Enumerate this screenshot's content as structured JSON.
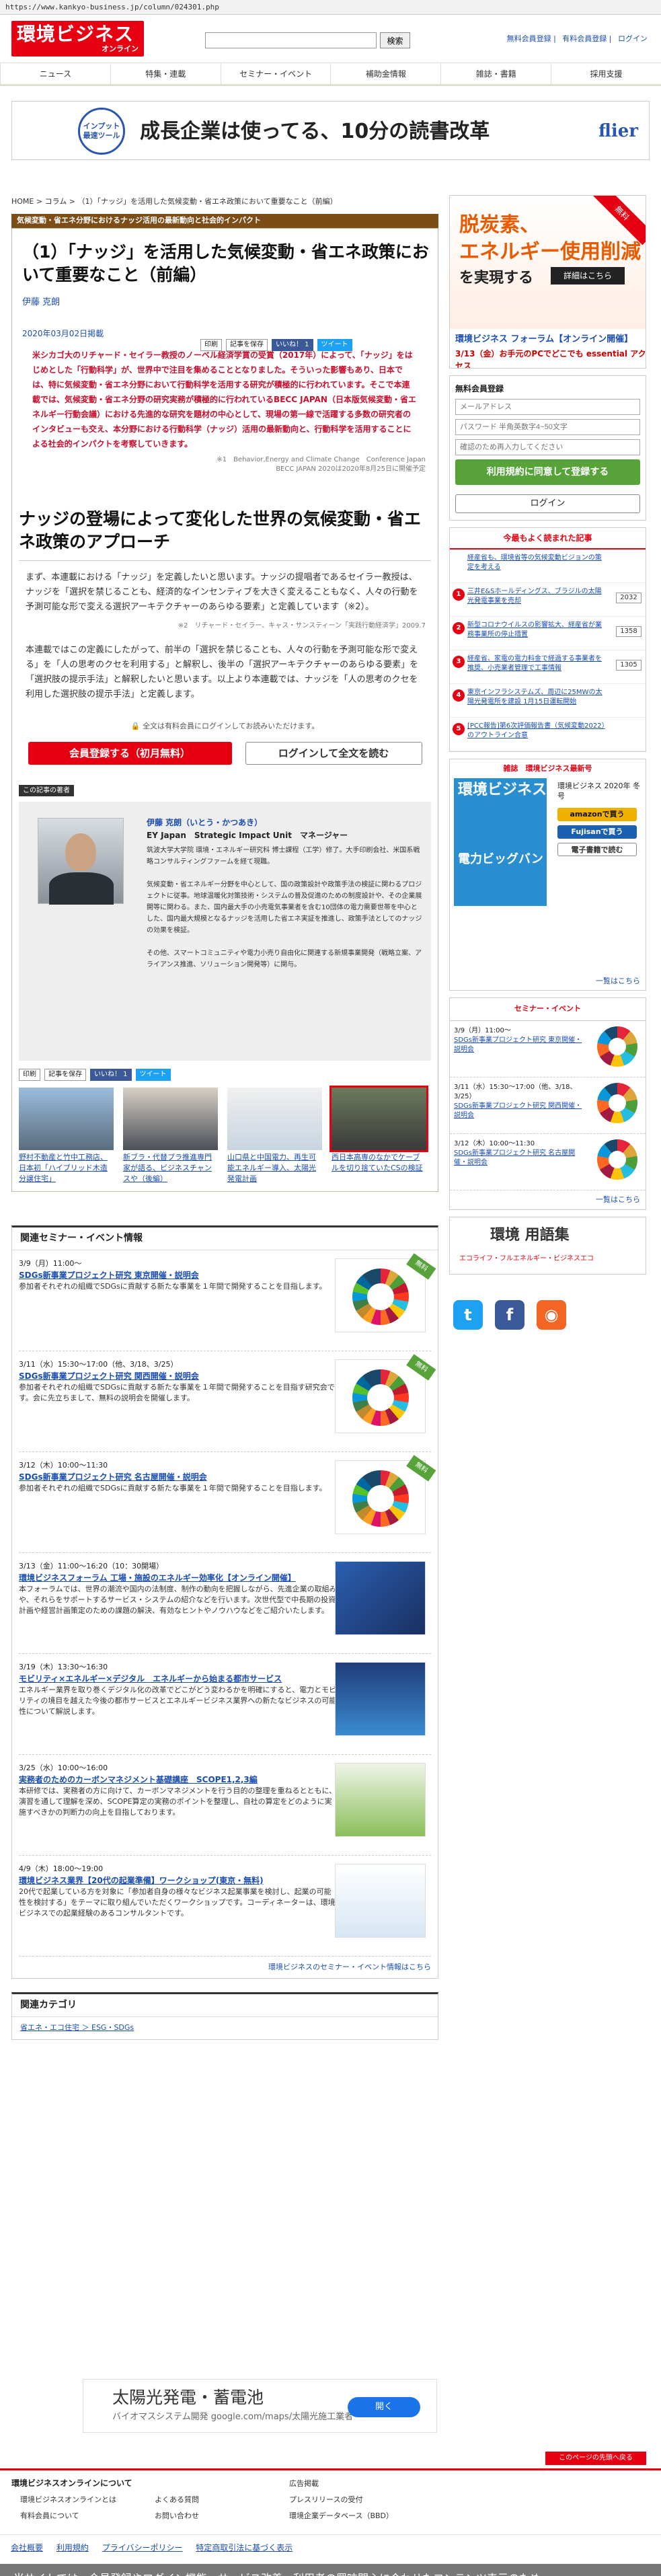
{
  "browser": {
    "url": "https://www.kankyo-business.jp/column/024301.php"
  },
  "header": {
    "logo_main": "環境ビジネス",
    "logo_sub": "オンライン",
    "search_placeholder": "",
    "search_button": "検索",
    "link1": "無料会員登録",
    "link2": "有料会員登録",
    "link3": "ログイン"
  },
  "nav": [
    "ニュース",
    "特集・連載",
    "セミナー・イベント",
    "補助金情報",
    "雑誌・書籍",
    "採用支援"
  ],
  "banner": {
    "badge": "インプット最速ツール",
    "text": "成長企業は使ってる、10分の読書改革",
    "brand": "flier"
  },
  "breadcrumb": "HOME > コラム > （1）「ナッジ」を活用した気候変動・省エネ政策において重要なこと（前編）",
  "article": {
    "series": "気候変動・省エネ分野におけるナッジ活用の最新動向と社会的インパクト",
    "title": "（1）「ナッジ」を活用した気候変動・省エネ政策において重要なこと（前編）",
    "author": "伊藤 克朗",
    "print": "印刷",
    "save": "記事を保存",
    "like": "いいね！ 1",
    "tweet": "ツイート",
    "date": "2020年03月02日掲載",
    "lead": "米シカゴ大のリチャード・セイラー教授のノーベル経済学賞の受賞（2017年）によって、「ナッジ」をはじめとした「行動科学」が、世界中で注目を集めることとなりました。そういった影響もあり、日本では、特に気候変動・省エネ分野において行動科学を活用する研究が積極的に行われています。そこで本連載では、気候変動・省エネ分野の研究実務が積極的に行われているBECC JAPAN（日本版気候変動・省エネルギー行動会議）における先進的な研究を題材の中心として、現場の第一線で活躍する多数の研究者のインタビューも交え、本分野における行動科学（ナッジ）活用の最新動向と、行動科学を活用することによる社会的インパクトを考察していきます。",
    "note1": "※1　Behavior,Energy and Climate Change　Conference Japan",
    "note1b": "BECC JAPAN 2020は2020年8月25日に開催予定",
    "h2": "ナッジの登場によって変化した世界の気候変動・省エネ政策のアプローチ",
    "p1": "まず、本連載における「ナッジ」を定義したいと思います。ナッジの提唱者であるセイラー教授は、ナッジを「選択を禁じることも、経済的なインセンティブを大きく変えることもなく、人々の行動を予測可能な形で変える選択アーキテクチャーのあらゆる要素」と定義しています（※2）。",
    "note2": "※2　リチャード・セイラー、キャス・サンスティーン「実践行動経済学」2009.7",
    "p2": "本連載ではこの定義にしたがって、前半の「選択を禁じることも、人々の行動を予測可能な形で変える」を「人の思考のクセを利用する」と解釈し、後半の「選択アーキテクチャーのあらゆる要素」を「選択肢の提示手法」と解釈したいと思います。以上より本連載では、ナッジを「人の思考のクセを利用した選択肢の提示手法」と定義します。",
    "lock": "全文は有料会員にログインしてお読みいただけます。",
    "cta_register": "会員登録する（初月無料）",
    "cta_login": "ログインして全文を読む"
  },
  "author_box": {
    "label": "この記事の著者",
    "name": "伊藤 克朗（いとう・かつあき）",
    "org": "EY Japan　Strategic Impact Unit　マネージャー",
    "bio1": "筑波大学大学院 環境・エネルギー研究科 博士課程（工学）修了。大手印刷会社、米国系戦略コンサルティングファームを経て現職。",
    "bio2": "気候変動・省エネルギー分野を中心として、国の政策設計や政策手法の検証に関わるプロジェクトに従事。地球温暖化対策技術・システムの普及促進のための制度設計や、その企業展開等に関わる。また、国内最大手の小売電気事業者を含む10団体の電力需要世帯を中心とした、国内最大規模となるナッジを活用した省エネ実証を推進し、政策手法としてのナッジの効果を検証。",
    "bio3": "その他、スマートコミュニティや電力小売り自由化に関連する新規事業開発（戦略立案、アライアンス推進、ソリューション開発等）に関与。"
  },
  "related": [
    "野村不動産と竹中工務店、日本初「ハイブリッド木造分譲住宅」",
    "新ブラ・代替プラ推進専門家が語る、ビジネスチャンスや（後編）",
    "山口県と中国電力、再生可能エネルギー導入、太陽光発電計画",
    "西日本高専のなかでケーブルを切り捨ていたCSの検証"
  ],
  "seminars": {
    "title": "関連セミナー・イベント情報",
    "items": [
      {
        "date": "3/9（月）11:00〜",
        "title": "SDGs新事業プロジェクト研究 東京開催・説明会",
        "text": "参加者それぞれの組織でSDGsに貢献する新たな事業を１年間で開発することを目指します。",
        "badge": "無料"
      },
      {
        "date": "3/11（水）15:30〜17:00（他、3/18、3/25）",
        "title": "SDGs新事業プロジェクト研究 関西開催・説明会",
        "text": "参加者それぞれの組織でSDGsに貢献する新たな事業を１年間で開発することを目指す研究会です。会に先立ちまして、無料の説明会を開催します。",
        "badge": "無料"
      },
      {
        "date": "3/12（木）10:00〜11:30",
        "title": "SDGs新事業プロジェクト研究 名古屋開催・説明会",
        "text": "参加者それぞれの組織でSDGsに貢献する新たな事業を１年間で開発することを目指します。",
        "badge": "無料"
      },
      {
        "date": "3/13（金）11:00〜16:20（10：30開場）",
        "title": "環境ビジネスフォーラム 工場・施設のエネルギー効率化【オンライン開催】",
        "text": "本フォーラムでは、世界の潮流や国内の法制度、制作の動向を把握しながら、先進企業の取組みや、それらをサポートするサービス・システムの紹介などを行います。次世代型で中長期の投資計画や経営計画策定のための課題の解決、有効なヒントやノウハウなどをご紹介いたします。",
        "badge": ""
      },
      {
        "date": "3/19（木）13:30〜16:30",
        "title": "モビリティ×エネルギー×デジタル　エネルギーから始まる都市サービス",
        "text": "エネルギー業界を取り巻くデジタル化の改革でどこがどう変わるかを明確にすると、電力とモビリティの境目を越えた今後の都市サービスとエネルギービジネス業界への新たなビジネスの可能性について解説します。",
        "badge": ""
      },
      {
        "date": "3/25（水）10:00〜16:00",
        "title": "実務者のためのカーボンマネジメント基礎講座　SCOPE1,2,3編",
        "text": "本研修では、実務者の方に向けて、カーボンマネジメントを行う目的の整理を重ねるとともに、演習を通して理解を深め、SCOPE算定の実務のポイントを整理し、自社の算定をどのように実施すべきかの判断力の向上を目指しております。",
        "badge": ""
      },
      {
        "date": "4/9（木）18:00〜19:00",
        "title": "環境ビジネス業界【20代の起業準備】ワークショップ(東京・無料)",
        "text": "20代で起業している方を対象に「参加者自身の様々なビジネス起業事業を検討し、起業の可能性を検討する」をテーマに取り組んでいただくワークショップです。コーディネーターは、環境ビジネスでの起業経験のあるコンサルタントです。",
        "badge": ""
      }
    ],
    "all": "環境ビジネスのセミナー・イベント情報はこちら"
  },
  "categories": {
    "title": "関連カテゴリ",
    "items": "省エネ・エコ住宅 ＞ ESG・SDGs"
  },
  "ad": {
    "title": "太陽光発電・蓄電池",
    "sub": "バイオマスシステム開発 google.com/maps/太陽光施工業者",
    "btn": "開く"
  },
  "pagetop": "このページの先頭へ戻る",
  "footer": {
    "h": "環境ビジネスオンラインについて",
    "links": [
      "環境ビジネスオンラインとは",
      "よくある質問",
      "有料会員について",
      "お問い合わせ",
      "広告掲載",
      "プレスリリースの受付",
      "環境企業データベース（BBD）"
    ],
    "bottom": [
      "会社概要",
      "利用規約",
      "プライバシーポリシー",
      "特定商取引法に基づく表示"
    ]
  },
  "cookie": "当サイトでは、会員登録やログイン機能、サービス改善、利用者の興味関心に合わせたコンテンツ表示のため",
  "sidebar": {
    "ad_t1": "脱炭素、",
    "ad_t2": "エネルギー使用削減",
    "ad_t3": "を実現する",
    "ad_btn": "詳細はこちら",
    "ad_forum": "環境ビジネス フォーラム【オンライン開催】",
    "ad_date": "3/13（金）お手元のPCでどこでも essential アクセス",
    "ad_ribbon": "無料",
    "reg_h": "無料会員登録",
    "reg_email": "メールアドレス",
    "reg_pw": "パスワード 半角英数字4~50文字",
    "reg_pw2": "確認のため再入力してください",
    "reg_btn": "利用規約に同意して登録する",
    "login": "ログイン",
    "rank_h": "今最もよく読まれた記事",
    "rank": [
      {
        "n": "",
        "t": "経産省も、環境省等の気候変動ビジョンの策定を考える",
        "c": ""
      },
      {
        "n": "1",
        "t": "三井E&Sホールディングス、ブラジルの太陽光発電事業を売却",
        "c": "2032"
      },
      {
        "n": "2",
        "t": "新型コロナウイルスの影響拡大、経産省が業務事業所の停止措置",
        "c": "1358"
      },
      {
        "n": "3",
        "t": "経産省、家電の電力料金で経過する事業者を推奨、小売業者管理で工事情報",
        "c": "1305"
      },
      {
        "n": "4",
        "t": "東京インフラシステムズ、周辺に25MWの太陽光発電所を建設 1月15日運転開始",
        "c": ""
      },
      {
        "n": "5",
        "t": "[PCC報告]第6次評価報告書（気候変動2022）のアウトライン合意",
        "c": ""
      }
    ],
    "mag_h": "雑誌　環境ビジネス最新号",
    "mag_t": "環境ビジネス",
    "mag_s": "電力ビッグバン",
    "mag_desc": "環境ビジネス 2020年 冬号",
    "mag_amazon": "amazonで買う",
    "mag_fujisan": "Fujisanで買う",
    "mag_ebook": "電子書籍で読む",
    "mag_more": "一覧はこちら",
    "sem_h": "セミナー・イベント",
    "sem": [
      {
        "d": "3/9（月）11:00〜",
        "t": "SDGs新事業プロジェクト研究 東京開催・説明会"
      },
      {
        "d": "3/11（水）15:30〜17:00（他、3/18、3/25）",
        "t": "SDGs新事業プロジェクト研究 関西開催・説明会"
      },
      {
        "d": "3/12（木）10:00〜11:30",
        "t": "SDGs新事業プロジェクト研究 名古屋開催・説明会"
      }
    ],
    "sem_more": "一覧はこちら",
    "yougo": "環境 用語集",
    "yougo_s": "エコライフ・フルエネルギー・ビジネスエコ"
  }
}
